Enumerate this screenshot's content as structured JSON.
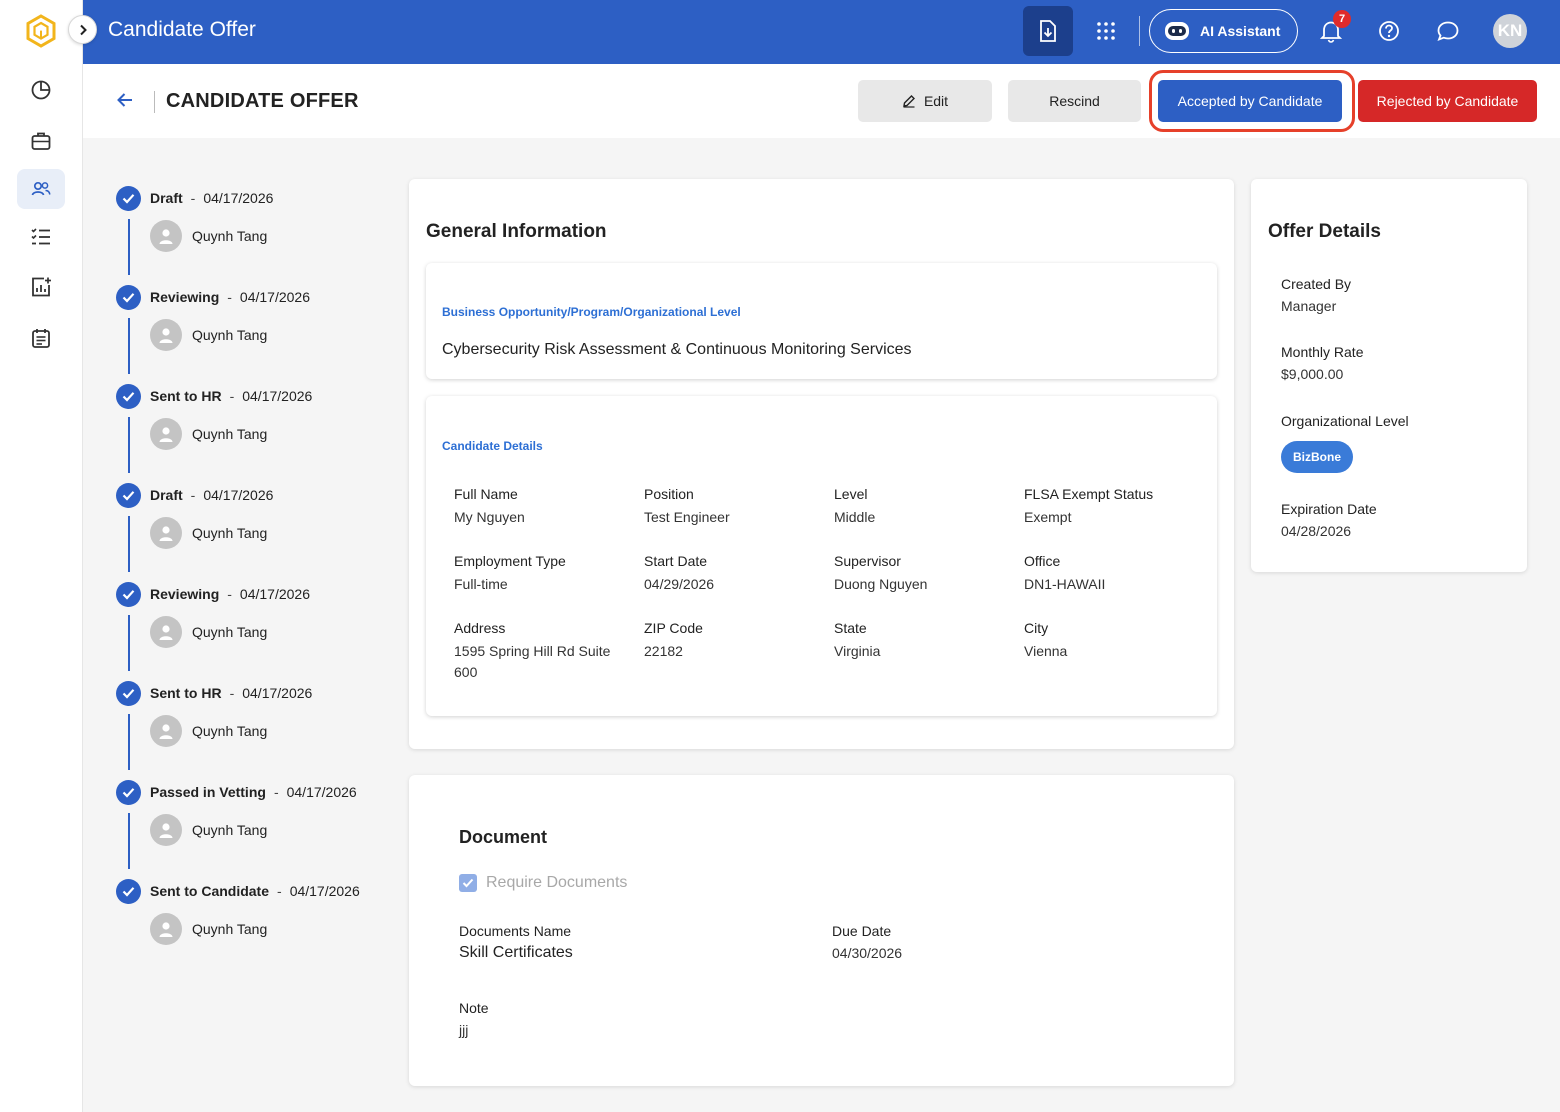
{
  "app": {
    "window_title": "Candidate Offer"
  },
  "rail": {
    "items": [
      {
        "name": "dashboard"
      },
      {
        "name": "briefcase"
      },
      {
        "name": "people",
        "active": true
      },
      {
        "name": "tasks"
      },
      {
        "name": "reports"
      },
      {
        "name": "calendar"
      }
    ]
  },
  "topbar": {
    "ai_label": "AI Assistant",
    "notification_count": "7",
    "avatar_initials": "KN"
  },
  "header": {
    "title": "CANDIDATE OFFER",
    "edit_label": "Edit",
    "rescind_label": "Rescind",
    "accept_label": "Accepted by Candidate",
    "reject_label": "Rejected by Candidate"
  },
  "timeline": [
    {
      "status": "Draft",
      "date": "04/17/2026",
      "user": "Quynh Tang"
    },
    {
      "status": "Reviewing",
      "date": "04/17/2026",
      "user": "Quynh Tang"
    },
    {
      "status": "Sent to HR",
      "date": "04/17/2026",
      "user": "Quynh Tang"
    },
    {
      "status": "Draft",
      "date": "04/17/2026",
      "user": "Quynh Tang"
    },
    {
      "status": "Reviewing",
      "date": "04/17/2026",
      "user": "Quynh Tang"
    },
    {
      "status": "Sent to HR",
      "date": "04/17/2026",
      "user": "Quynh Tang"
    },
    {
      "status": "Passed in Vetting",
      "date": "04/17/2026",
      "user": "Quynh Tang"
    },
    {
      "status": "Sent to Candidate",
      "date": "04/17/2026",
      "user": "Quynh Tang"
    }
  ],
  "general": {
    "title": "General Information",
    "bop_label": "Business Opportunity/Program/Organizational Level",
    "bop_value": "Cybersecurity Risk Assessment & Continuous Monitoring Services",
    "candidate_label": "Candidate Details",
    "fields": [
      {
        "label": "Full Name",
        "value": "My Nguyen"
      },
      {
        "label": "Position",
        "value": "Test Engineer"
      },
      {
        "label": "Level",
        "value": "Middle"
      },
      {
        "label": "FLSA Exempt Status",
        "value": "Exempt"
      },
      {
        "label": "Employment Type",
        "value": "Full-time"
      },
      {
        "label": "Start Date",
        "value": "04/29/2026"
      },
      {
        "label": "Supervisor",
        "value": "Duong Nguyen"
      },
      {
        "label": "Office",
        "value": "DN1-HAWAII"
      },
      {
        "label": "Address",
        "value": "1595 Spring Hill Rd Suite 600"
      },
      {
        "label": "ZIP Code",
        "value": "22182"
      },
      {
        "label": "State",
        "value": "Virginia"
      },
      {
        "label": "City",
        "value": "Vienna"
      }
    ]
  },
  "offer": {
    "title": "Offer Details",
    "created_by_label": "Created By",
    "created_by_value": "Manager",
    "monthly_rate_label": "Monthly Rate",
    "monthly_rate_value": "$9,000.00",
    "org_level_label": "Organizational Level",
    "org_level_value": "BizBone",
    "expiration_label": "Expiration Date",
    "expiration_value": "04/28/2026"
  },
  "document": {
    "title": "Document",
    "require_label": "Require Documents",
    "require_checked": true,
    "docs_name_label": "Documents Name",
    "docs_name_value": "Skill Certificates",
    "due_date_label": "Due Date",
    "due_date_value": "04/30/2026",
    "note_label": "Note",
    "note_value": "jjj"
  },
  "colors": {
    "primary": "#2d5fc4",
    "danger": "#d62828",
    "highlight": "#e6402a",
    "link_label": "#2d6fd4"
  }
}
